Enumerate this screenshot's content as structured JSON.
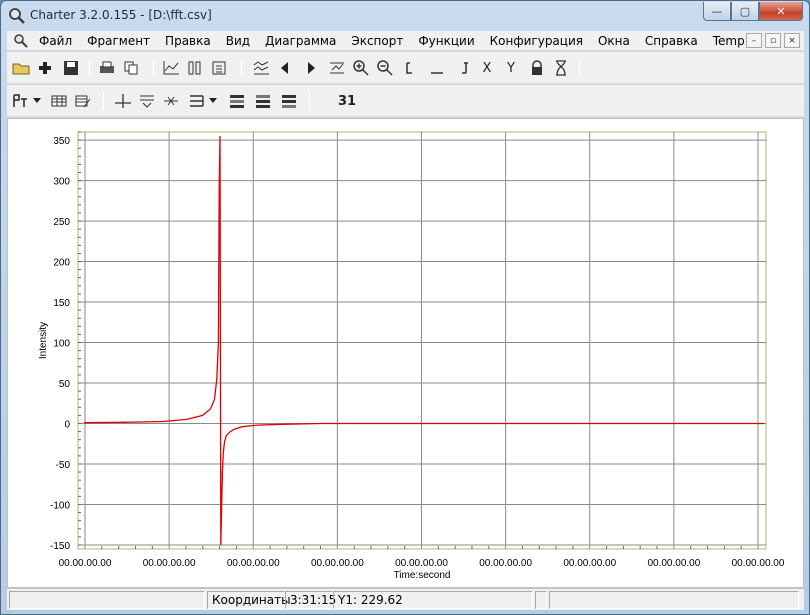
{
  "window": {
    "title": "Charter 3.2.0.155 - [D:\\fft.csv]",
    "minimize": "—",
    "maximize": "▢",
    "close": "✕"
  },
  "menu": {
    "items": [
      "Файл",
      "Фрагмент",
      "Правка",
      "Вид",
      "Диаграмма",
      "Экспорт",
      "Функции",
      "Конфигурация",
      "Окна",
      "Справка",
      "Temp"
    ],
    "mdi": [
      "–",
      "▫",
      "×"
    ]
  },
  "toolbar1": {
    "x_label": "X",
    "y_label": "Y"
  },
  "toolbar2": {
    "text_button": "31"
  },
  "chart_data": {
    "type": "line",
    "title": "",
    "xlabel": "Time:second",
    "ylabel": "Intensity",
    "ylim": [
      -155,
      360
    ],
    "yticks": [
      350,
      300,
      250,
      200,
      150,
      100,
      50,
      0,
      -50,
      -100,
      -150
    ],
    "xtick_labels": [
      "00.00.00.00",
      "00.00.00.00",
      "00.00.00.00",
      "00.00.00.00",
      "00.00.00.00",
      "00.00.00.00",
      "00.00.00.00",
      "00.00.00.00",
      "00.00.00.00"
    ],
    "grid": true,
    "legend": "none",
    "series_color": "#e00000",
    "series": [
      {
        "x": [
          0.0,
          0.5,
          1.0,
          1.3,
          1.5,
          1.6,
          1.65,
          1.68,
          1.7,
          1.71,
          1.72,
          1.73,
          1.74,
          1.75,
          1.76,
          1.77,
          1.78,
          1.8,
          1.85,
          1.9,
          2.0,
          2.2,
          2.5,
          3.0,
          3.5,
          4.0,
          5.0,
          6.0,
          7.0,
          8.0,
          8.6
        ],
        "values": [
          1,
          1.5,
          2.5,
          5,
          10,
          18,
          30,
          55,
          100,
          290,
          355,
          -150,
          -105,
          -60,
          -38,
          -28,
          -22,
          -15,
          -10,
          -7,
          -4,
          -2,
          -1,
          0,
          0,
          0,
          0,
          0,
          0,
          0,
          0
        ]
      }
    ]
  },
  "status": {
    "coords_label": "Координаты",
    "time": "3:31:15",
    "y1": "Y1: 229.62"
  }
}
